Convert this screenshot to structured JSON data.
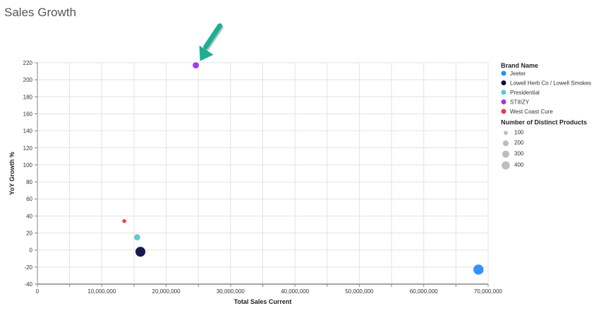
{
  "page": {
    "title": "Sales Growth"
  },
  "chart_data": {
    "type": "scatter",
    "xlabel": "Total Sales Current",
    "ylabel": "YoY Growth %",
    "xlim": [
      0,
      70000000
    ],
    "ylim": [
      -40,
      220
    ],
    "x_ticks": [
      "0",
      "10,000,000",
      "20,000,000",
      "30,000,000",
      "40,000,000",
      "50,000,000",
      "60,000,000",
      "70,000,000"
    ],
    "y_ticks": [
      "-40",
      "-20",
      "0",
      "20",
      "40",
      "60",
      "80",
      "100",
      "120",
      "140",
      "160",
      "180",
      "200",
      "220"
    ],
    "grid": true,
    "points": [
      {
        "brand": "Jeeter",
        "x": 68500000,
        "y": -23,
        "products": 400,
        "color": "#2b8cf5"
      },
      {
        "brand": "Lowell Herb Co / Lowell Smokes",
        "x": 16000000,
        "y": -2,
        "products": 380,
        "color": "#0d0d45"
      },
      {
        "brand": "Presidential",
        "x": 15500000,
        "y": 15,
        "products": 150,
        "color": "#5cc8c8"
      },
      {
        "brand": "STIIIZY",
        "x": 24600000,
        "y": 217,
        "products": 150,
        "color": "#a030f0"
      },
      {
        "brand": "West Coast Cure",
        "x": 13500000,
        "y": 34,
        "products": 60,
        "color": "#e8374d"
      }
    ],
    "legend": {
      "placement": "right",
      "color_title": "Brand Name",
      "color_items": [
        {
          "label": "Jeeter",
          "color": "#2b8cf5"
        },
        {
          "label": "Lowell Herb Co / Lowell Smokes",
          "color": "#0d0d45"
        },
        {
          "label": "Presidential",
          "color": "#5cc8c8"
        },
        {
          "label": "STIIIZY",
          "color": "#a030f0"
        },
        {
          "label": "West Coast Cure",
          "color": "#e8374d"
        }
      ],
      "size_title": "Number of Distinct Products",
      "size_items": [
        {
          "label": "100",
          "value": 100
        },
        {
          "label": "200",
          "value": 200
        },
        {
          "label": "300",
          "value": 300
        },
        {
          "label": "400",
          "value": 400
        }
      ]
    },
    "annotation": {
      "type": "arrow",
      "color": "#1fae94",
      "points_to": "STIIIZY"
    }
  }
}
